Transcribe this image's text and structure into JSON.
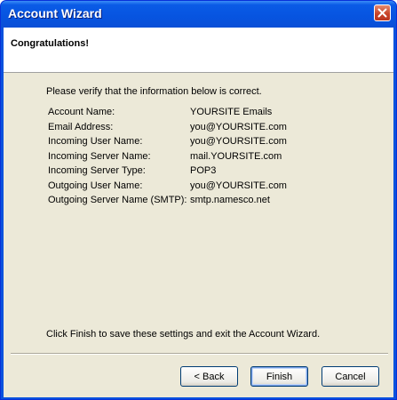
{
  "window": {
    "title": "Account Wizard"
  },
  "header": {
    "heading": "Congratulations!"
  },
  "main": {
    "intro": "Please verify that the information below is correct.",
    "rows": [
      {
        "label": "Account Name:",
        "value": "YOURSITE Emails"
      },
      {
        "label": "Email Address:",
        "value": "you@YOURSITE.com"
      },
      {
        "label": "Incoming User Name:",
        "value": "you@YOURSITE.com"
      },
      {
        "label": "Incoming Server Name:",
        "value": "mail.YOURSITE.com"
      },
      {
        "label": "Incoming Server Type:",
        "value": "POP3"
      },
      {
        "label": "Outgoing User Name:",
        "value": "you@YOURSITE.com"
      },
      {
        "label": "Outgoing Server Name (SMTP):",
        "value": "smtp.namesco.net"
      }
    ],
    "footer_text": "Click Finish to save these settings and exit the Account Wizard."
  },
  "buttons": {
    "back": "< Back",
    "finish": "Finish",
    "cancel": "Cancel"
  },
  "icons": {
    "close": "close-icon"
  },
  "colors": {
    "titlebar": "#0a5be6",
    "dialog_bg": "#ece9d8",
    "close_button": "#c8452a"
  }
}
